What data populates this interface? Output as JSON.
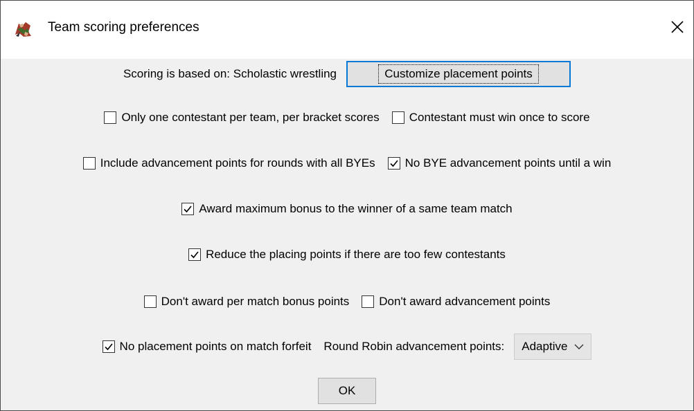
{
  "window": {
    "title": "Team scoring preferences",
    "close_symbol": "✕",
    "icon": "wrestling-app-icon"
  },
  "scoring": {
    "based_on_text": "Scoring is based on: Scholastic wrestling",
    "customize_button": "Customize placement points"
  },
  "options": {
    "one_per_team": {
      "label": "Only one contestant per team, per bracket scores",
      "checked": false
    },
    "must_win_once": {
      "label": "Contestant must win once to score",
      "checked": false
    },
    "include_bye_rounds": {
      "label": "Include advancement points for rounds with all BYEs",
      "checked": false
    },
    "no_bye_until_win": {
      "label": "No BYE advancement points until a win",
      "checked": true
    },
    "max_bonus_same_team": {
      "label": "Award maximum bonus to the winner of a same team match",
      "checked": true
    },
    "reduce_placing": {
      "label": "Reduce the placing points if there are too few contestants",
      "checked": true
    },
    "no_per_match_bonus": {
      "label": "Don't award per match bonus points",
      "checked": false
    },
    "no_advancement": {
      "label": "Don't award advancement points",
      "checked": false
    },
    "no_placement_forfeit": {
      "label": "No placement points on match forfeit",
      "checked": true
    }
  },
  "round_robin": {
    "label": "Round Robin advancement points:",
    "selected": "Adaptive"
  },
  "ok_button": "OK",
  "colors": {
    "dialog_bg": "#f0f0f0",
    "titlebar_bg": "#ffffff",
    "focus_border": "#0078d7",
    "button_bg": "#e1e1e1"
  }
}
